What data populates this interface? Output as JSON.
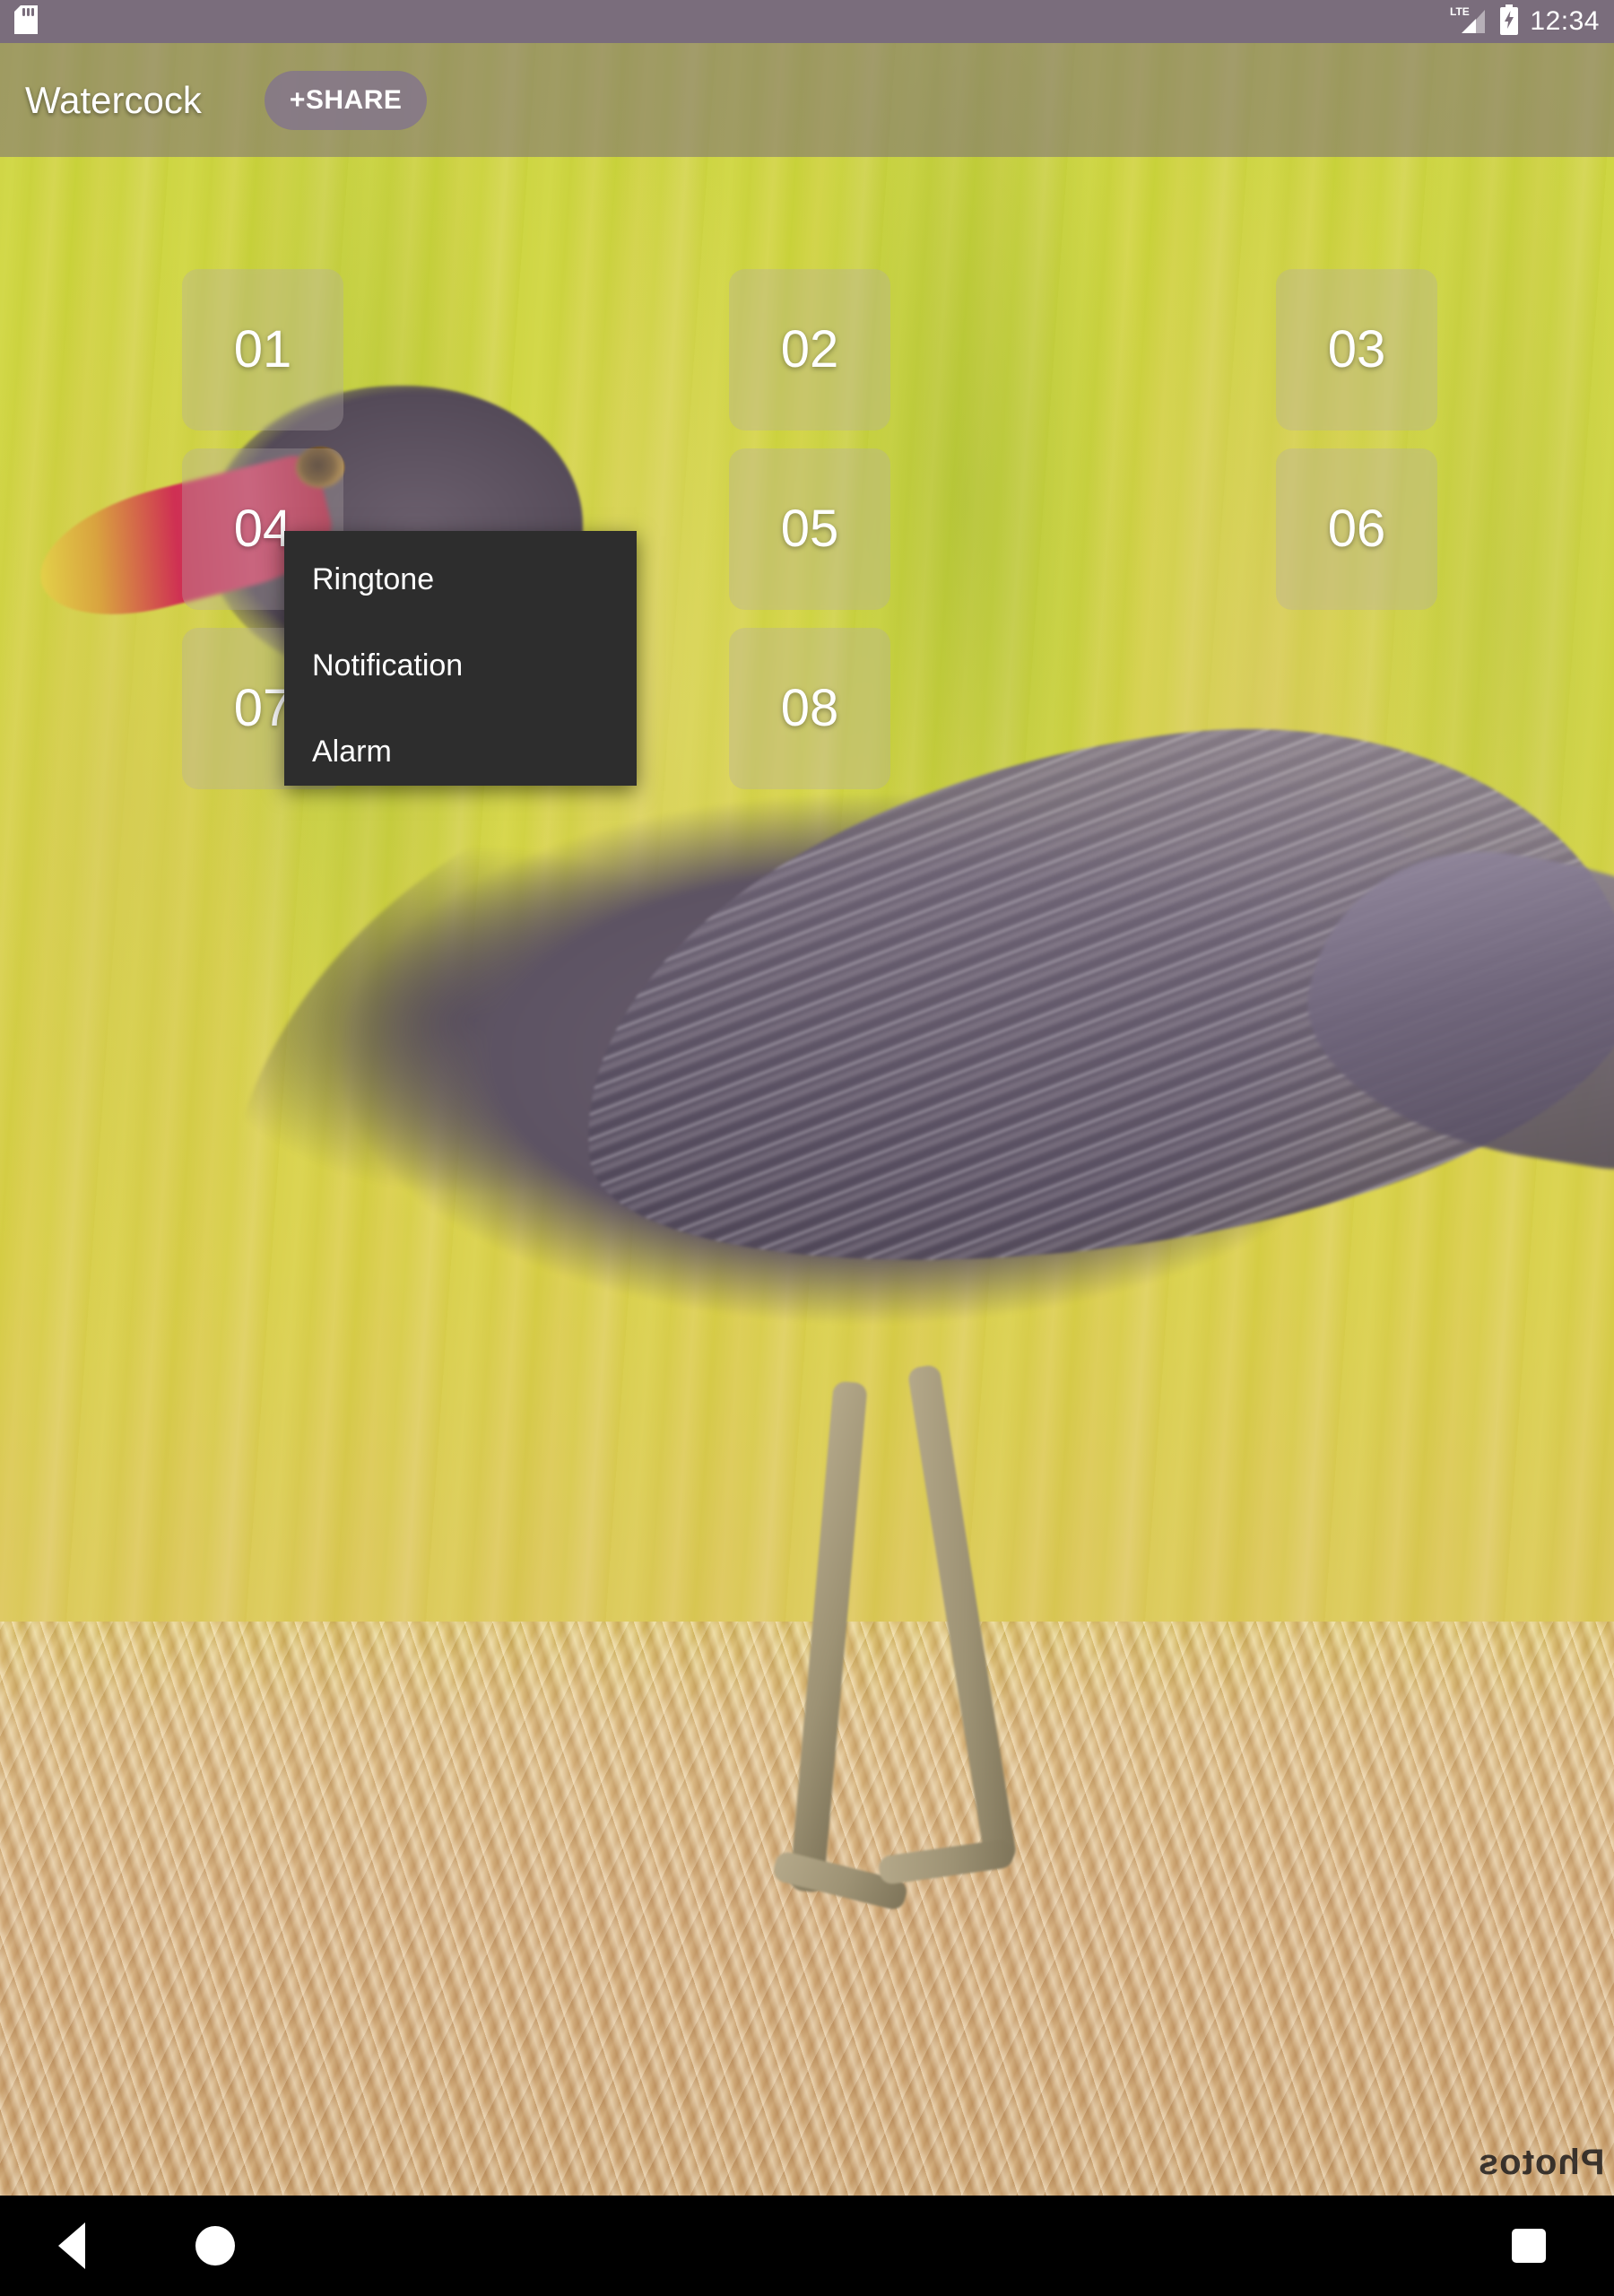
{
  "status_bar": {
    "sd_card_icon": "sd-card-icon",
    "network_icon": "lte-signal-icon",
    "network_label": "LTE",
    "battery_icon": "battery-charging-icon",
    "time": "12:34"
  },
  "app_bar": {
    "title": "Watercock",
    "share_label": "+SHARE"
  },
  "sound_grid": {
    "pads": [
      {
        "label": "01"
      },
      {
        "label": "02"
      },
      {
        "label": "03"
      },
      {
        "label": "04"
      },
      {
        "label": "05"
      },
      {
        "label": "06"
      },
      {
        "label": "07"
      },
      {
        "label": "08"
      }
    ]
  },
  "context_menu": {
    "items": [
      {
        "label": "Ringtone"
      },
      {
        "label": "Notification"
      },
      {
        "label": "Alarm"
      }
    ]
  },
  "background": {
    "watermark": "Photos",
    "subject": "watercock bird standing on straw nest in rice field"
  },
  "nav_bar": {
    "back_icon": "back-triangle-icon",
    "home_icon": "home-circle-icon",
    "recents_icon": "recents-square-icon"
  },
  "colors": {
    "status_bar_bg": "#7a6d7c",
    "app_bar_bg": "rgba(120,108,122,0.55)",
    "menu_bg": "#2d2d2d",
    "pad_bg": "rgba(180,170,170,0.33)",
    "nav_bg": "#000000",
    "text_on_dark": "#ffffff"
  }
}
